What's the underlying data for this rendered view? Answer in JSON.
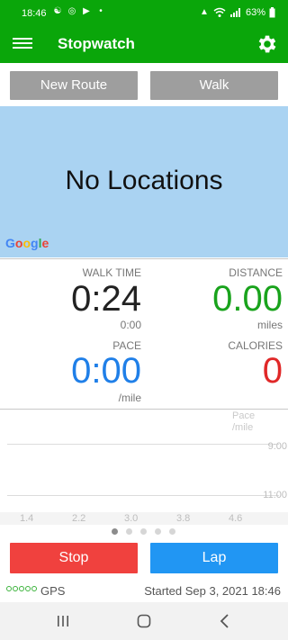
{
  "status_bar": {
    "time": "18:46",
    "battery": "63%",
    "icons": [
      "notification-icon",
      "cast-icon",
      "media-icon",
      "dot-icon"
    ]
  },
  "app_bar": {
    "title": "Stopwatch"
  },
  "top_buttons": {
    "new_route": "New Route",
    "walk": "Walk"
  },
  "map": {
    "message": "No Locations",
    "attribution": "Google",
    "background": "#aad3f2"
  },
  "stats": {
    "walk_time": {
      "label": "WALK TIME",
      "value": "0:24",
      "sub": "0:00"
    },
    "distance": {
      "label": "DISTANCE",
      "value": "0.00",
      "sub": "miles",
      "color": "#19a31c"
    },
    "pace": {
      "label": "PACE",
      "value": "0:00",
      "sub": "/mile",
      "color": "#1f7fe8"
    },
    "calories": {
      "label": "CALORIES",
      "value": "0",
      "color": "#e02828"
    }
  },
  "graph": {
    "unit_line1": "Pace",
    "unit_line2": "/mile",
    "y_labels": [
      "9:00",
      "11:00"
    ],
    "x_labels": [
      "1.4",
      "2.2",
      "3.0",
      "3.8",
      "4.6"
    ]
  },
  "pager": {
    "count": 5,
    "active": 0
  },
  "bottom_buttons": {
    "stop": "Stop",
    "lap": "Lap"
  },
  "footer": {
    "gps_label": "GPS",
    "started": "Started Sep 3, 2021 18:46"
  },
  "colors": {
    "brand_green": "#0aa60a",
    "stop_red": "#f0413e",
    "lap_blue": "#2196f3",
    "top_button_grey": "#9e9e9e"
  }
}
